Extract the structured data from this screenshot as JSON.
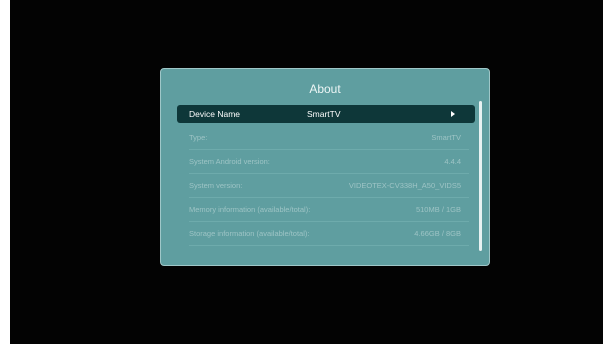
{
  "dialog": {
    "title": "About",
    "selected_row": {
      "label": "Device Name",
      "value": "SmartTV",
      "icon": "chevron-right-icon"
    },
    "rows": [
      {
        "label": "Type:",
        "value": "SmartTV"
      },
      {
        "label": "System Android version:",
        "value": "4.4.4"
      },
      {
        "label": "System version:",
        "value": "VIDEOTEX-CV338H_A50_VIDS5"
      },
      {
        "label": "Memory information (available/total):",
        "value": "510MB / 1GB"
      },
      {
        "label": "Storage information (available/total):",
        "value": "4.66GB / 8GB"
      }
    ]
  },
  "colors": {
    "screen_background": "#030303",
    "dialog_background": "#5f9ea0",
    "selected_row_background": "#0e3739",
    "info_text": "#9dc4c5"
  }
}
